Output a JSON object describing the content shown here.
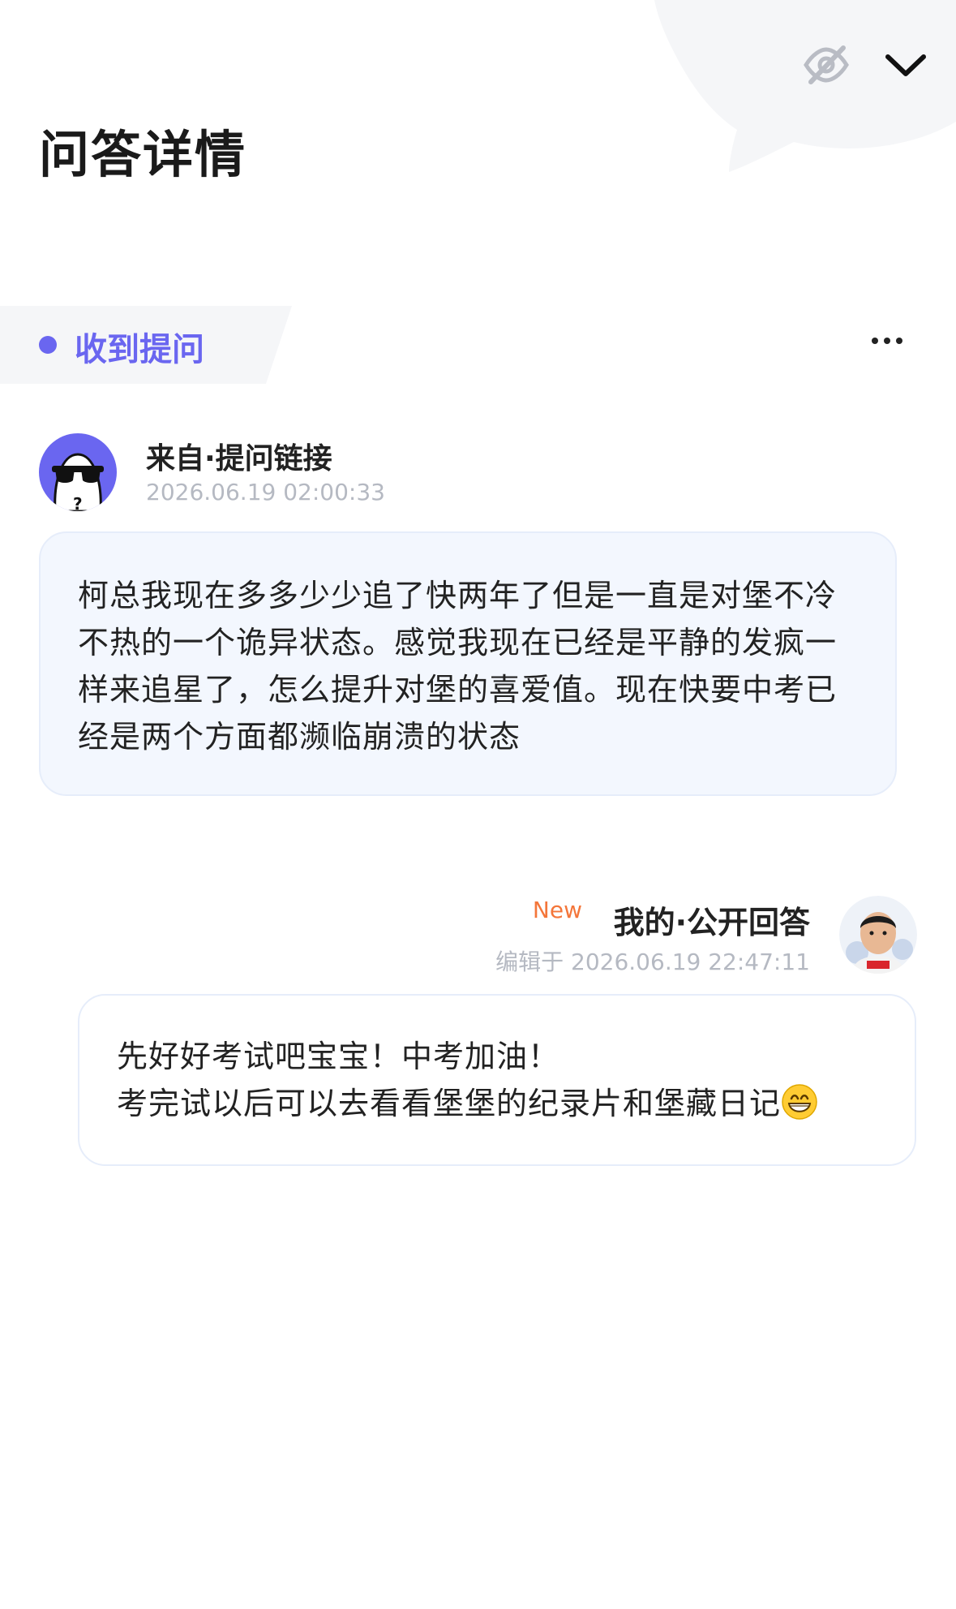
{
  "header": {
    "title": "问答详情",
    "icons": [
      "eye-off-icon",
      "chevron-down-icon"
    ]
  },
  "section": {
    "label": "收到提问",
    "accent_color": "#6a66f0"
  },
  "question": {
    "source": "来自·提问链接",
    "time": "2026.06.19 02:00:33",
    "text": "柯总我现在多多少少追了快两年了但是一直是对堡不冷不热的一个诡异状态。感觉我现在已经是平静的发疯一样来追星了，怎么提升对堡的喜爱值。现在快要中考已经是两个方面都濒临崩溃的状态"
  },
  "answer": {
    "badge": "New",
    "badge_color": "#f4763a",
    "title": "我的·公开回答",
    "time": "编辑于 2026.06.19 22:47:11",
    "line1": "先好好考试吧宝宝！中考加油！",
    "line2": "考完试以后可以去看看堡堡的纪录片和堡藏日记",
    "emoji": "grinning-face-emoji"
  }
}
